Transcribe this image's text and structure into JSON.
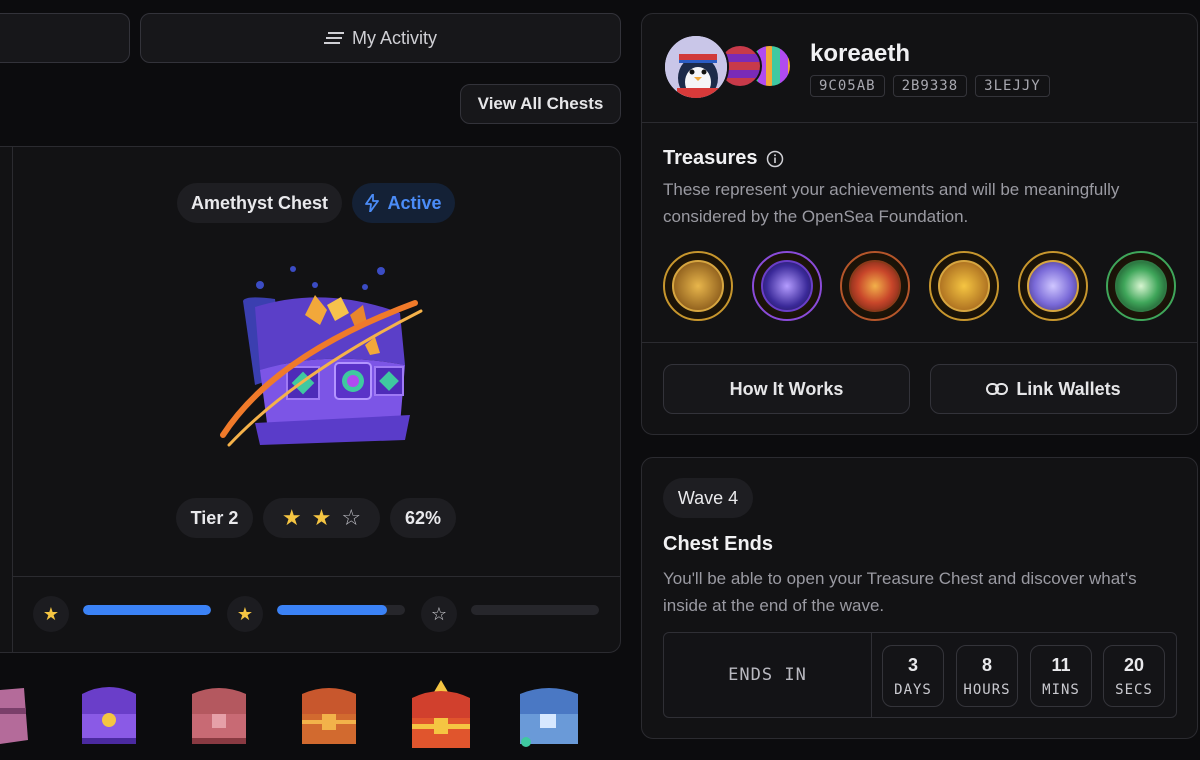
{
  "top": {
    "my_activity_label": "My Activity",
    "view_all_label": "View All Chests"
  },
  "chest": {
    "name": "Amethyst Chest",
    "status": "Active",
    "tier": "Tier 2",
    "stars_filled": 2,
    "stars_total": 3,
    "percent": "62%",
    "progress": [
      1.0,
      0.86,
      0.0
    ]
  },
  "profile": {
    "username": "koreaeth",
    "tags": [
      "9C05AB",
      "2B9338",
      "3LEJJY"
    ]
  },
  "treasures": {
    "title": "Treasures",
    "description": "These represent your achievements and will be meaningfully considered by the OpenSea Foundation.",
    "medals": [
      "gold-cog-medal",
      "purple-orb-medal",
      "fire-medal",
      "gold-chest-medal",
      "compass-medal",
      "green-leaf-medal"
    ],
    "how_it_works_label": "How It Works",
    "link_wallets_label": "Link Wallets"
  },
  "wave": {
    "label": "Wave 4",
    "title": "Chest Ends",
    "description": "You'll be able to open your Treasure Chest and discover what's inside at the end of the wave.",
    "ends_in_label": "ENDS IN",
    "countdown": [
      {
        "value": "3",
        "unit": "DAYS"
      },
      {
        "value": "8",
        "unit": "HOURS"
      },
      {
        "value": "11",
        "unit": "MINS"
      },
      {
        "value": "20",
        "unit": "SECS"
      }
    ]
  },
  "colors": {
    "accent": "#3b82f6",
    "star": "#f5c542",
    "gold": "#c7962d",
    "purple": "#8a4bd8",
    "green": "#3fa65a"
  }
}
